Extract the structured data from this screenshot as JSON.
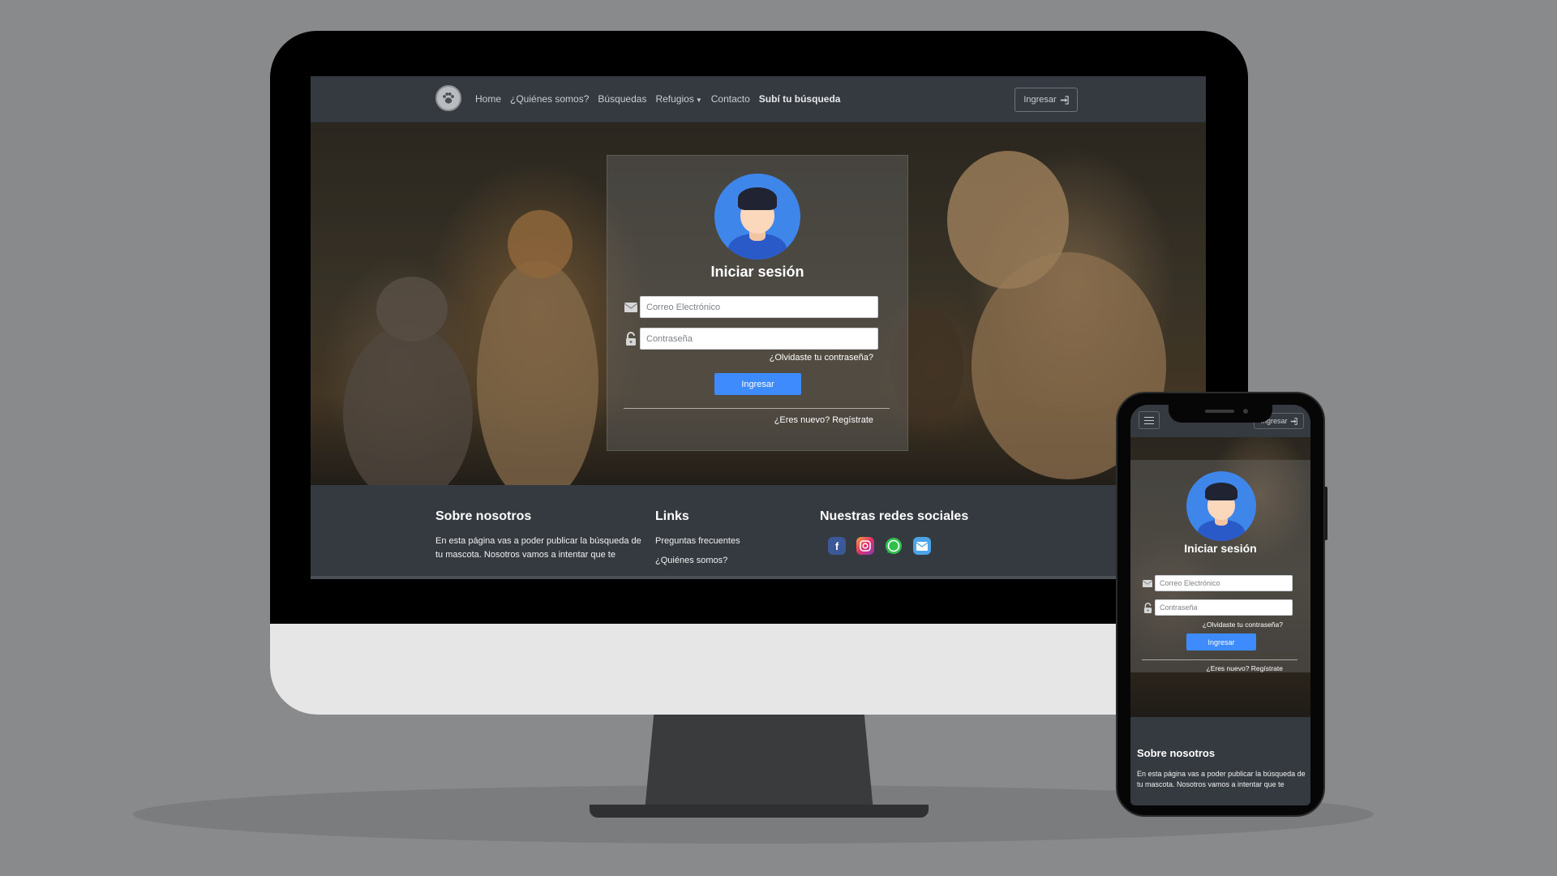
{
  "colors": {
    "background": "#898a8c",
    "navbar": "#343a40",
    "primary_button": "#3d8bfd",
    "avatar_bg": "#3f86ea"
  },
  "nav": {
    "links": [
      {
        "label": "Home"
      },
      {
        "label": "¿Quiénes somos?"
      },
      {
        "label": "Búsquedas"
      },
      {
        "label": "Refugios"
      },
      {
        "label": "Contacto"
      },
      {
        "label": "Subí tu búsqueda"
      }
    ],
    "login_button": "Ingresar",
    "login_icon": "sign-in-icon"
  },
  "login": {
    "title": "Iniciar sesión",
    "email_placeholder": "Correo Electrónico",
    "password_placeholder": "Contraseña",
    "forgot_link": "¿Olvidaste tu contraseña?",
    "submit_label": "Ingresar",
    "register_link": "¿Eres nuevo? Regístrate"
  },
  "footer": {
    "about_title": "Sobre nosotros",
    "about_text": "En esta página vas a poder publicar la búsqueda de tu mascota. Nosotros vamos a intentar que te",
    "links_title": "Links",
    "links": [
      "Preguntas frecuentes",
      "¿Quiénes somos?"
    ],
    "social_title": "Nuestras redes sociales",
    "social_icons": [
      "facebook-icon",
      "instagram-icon",
      "whatsapp-icon",
      "email-icon"
    ]
  },
  "mobile": {
    "login_button": "Ingresar",
    "login_title": "Iniciar sesión",
    "email_placeholder": "Correo Electrónico",
    "password_placeholder": "Contraseña",
    "forgot_link": "¿Olvidaste tu contraseña?",
    "submit_label": "Ingresar",
    "register_link": "¿Eres nuevo? Regístrate",
    "about_title": "Sobre nosotros",
    "about_text": "En esta página vas a poder publicar la búsqueda de tu mascota. Nosotros vamos a intentar que te"
  }
}
